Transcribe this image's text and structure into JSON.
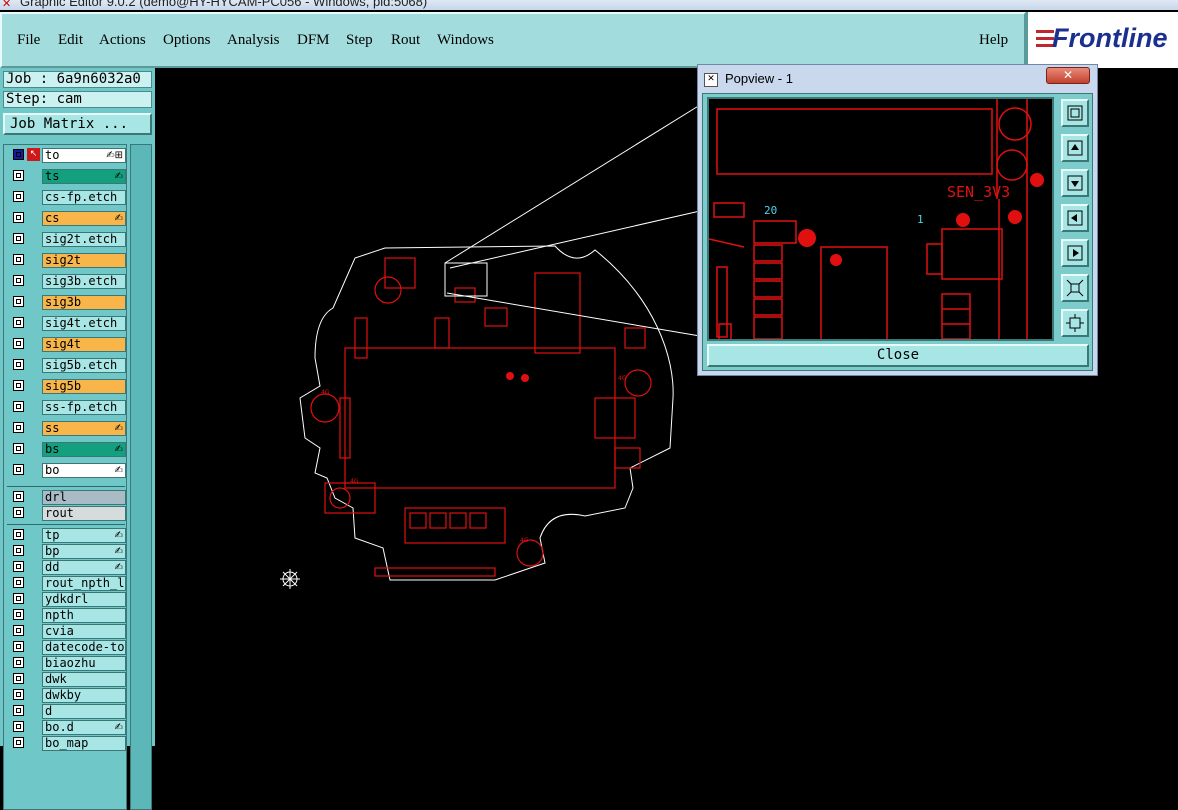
{
  "window": {
    "title": "Graphic Editor 9.0.2 (demo@HY-HYCAM-PC056 - Windows, pid:5068)"
  },
  "menu": {
    "items": [
      "File",
      "Edit",
      "Actions",
      "Options",
      "Analysis",
      "DFM",
      "Step",
      "Rout",
      "Windows"
    ],
    "help": "Help"
  },
  "logo": {
    "text": "Frontline"
  },
  "job": {
    "job_label": "Job : 6a9n6032a0",
    "step_label": "Step: cam"
  },
  "job_matrix": {
    "label": "Job Matrix ..."
  },
  "layers": [
    {
      "name": "to",
      "color": "#ffffff",
      "mark": "✍⊞"
    },
    {
      "name": "ts",
      "color": "#14a07f",
      "mark": "✍"
    },
    {
      "name": "cs-fp.etch",
      "color": "#a8e6e6",
      "mark": ""
    },
    {
      "name": "cs",
      "color": "#f8b64a",
      "mark": "✍"
    },
    {
      "name": "sig2t.etch",
      "color": "#a8e6e6",
      "mark": ""
    },
    {
      "name": "sig2t",
      "color": "#f8b64a",
      "mark": ""
    },
    {
      "name": "sig3b.etch",
      "color": "#a8e6e6",
      "mark": ""
    },
    {
      "name": "sig3b",
      "color": "#f8b64a",
      "mark": ""
    },
    {
      "name": "sig4t.etch",
      "color": "#a8e6e6",
      "mark": ""
    },
    {
      "name": "sig4t",
      "color": "#f8b64a",
      "mark": ""
    },
    {
      "name": "sig5b.etch",
      "color": "#a8e6e6",
      "mark": ""
    },
    {
      "name": "sig5b",
      "color": "#f8b64a",
      "mark": ""
    },
    {
      "name": "ss-fp.etch",
      "color": "#a8e6e6",
      "mark": ""
    },
    {
      "name": "ss",
      "color": "#f8b64a",
      "mark": "✍"
    },
    {
      "name": "bs",
      "color": "#14a07f",
      "mark": "✍"
    },
    {
      "name": "bo",
      "color": "#ffffff",
      "mark": "✍"
    },
    {
      "name": "drl",
      "color": "#a9bcc6",
      "mark": ""
    },
    {
      "name": "rout",
      "color": "#d6dcdc",
      "mark": ""
    },
    {
      "name": "tp",
      "color": "#a8e6e6",
      "mark": "✍"
    },
    {
      "name": "bp",
      "color": "#a8e6e6",
      "mark": "✍"
    },
    {
      "name": "dd",
      "color": "#a8e6e6",
      "mark": "✍"
    },
    {
      "name": "rout_npth_layer",
      "color": "#a8e6e6",
      "mark": ""
    },
    {
      "name": "ydkdrl",
      "color": "#a8e6e6",
      "mark": ""
    },
    {
      "name": "npth",
      "color": "#a8e6e6",
      "mark": ""
    },
    {
      "name": "cvia",
      "color": "#a8e6e6",
      "mark": ""
    },
    {
      "name": "datecode-to",
      "color": "#a8e6e6",
      "mark": ""
    },
    {
      "name": "biaozhu",
      "color": "#a8e6e6",
      "mark": ""
    },
    {
      "name": "dwk",
      "color": "#a8e6e6",
      "mark": ""
    },
    {
      "name": "dwkby",
      "color": "#a8e6e6",
      "mark": ""
    },
    {
      "name": "d",
      "color": "#a8e6e6",
      "mark": ""
    },
    {
      "name": "bo.d",
      "color": "#a8e6e6",
      "mark": "✍"
    },
    {
      "name": "bo_map",
      "color": "#a8e6e6",
      "mark": ""
    }
  ],
  "popview": {
    "title": "Popview - 1",
    "close_x": "✕",
    "close_button": "Close",
    "label_net": "SEN_3V3",
    "label_pin20": "20",
    "label_pin1": "1"
  },
  "board": {
    "labels": [
      "4G",
      "4G",
      "4G",
      "4G"
    ],
    "trace_color": "#e01010",
    "outline_color": "#ffffff"
  }
}
